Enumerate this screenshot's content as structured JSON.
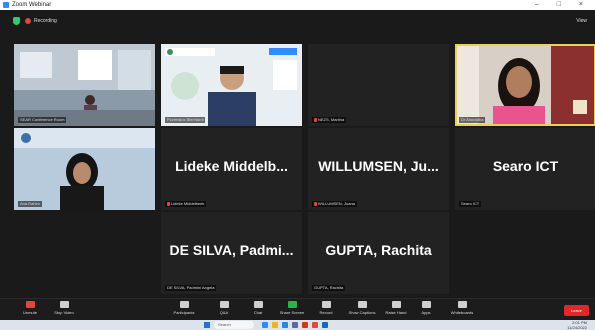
{
  "window": {
    "title": "Zoom Webinar",
    "controls": "– □ ×"
  },
  "topbar": {
    "recording_label": "Recording",
    "view_label": "View"
  },
  "tiles": [
    {
      "label": "SEAR Conference Room",
      "big_name": "",
      "video": "room"
    },
    {
      "label": "Florensius Blenhardi",
      "big_name": "",
      "video": "man"
    },
    {
      "label": "NEZS, Martina",
      "big_name": "",
      "video": "blank"
    },
    {
      "label": "Dr Anuradha",
      "big_name": "",
      "video": "woman",
      "active": true
    },
    {
      "label": "Ana Rahim",
      "big_name": "",
      "video": "hijab"
    },
    {
      "label": "Lideke Middelbeek",
      "big_name": "Lideke Middelb...",
      "video": "none"
    },
    {
      "label": "WILLUMSEN, Juana",
      "big_name": "WILLUMSEN, Ju...",
      "video": "none"
    },
    {
      "label": "Searo ICT",
      "big_name": "Searo ICT",
      "video": "none"
    },
    {
      "label": "",
      "big_name": "",
      "video": "empty"
    },
    {
      "label": "DE SILVA, Padmini Angela",
      "big_name": "DE SILVA, Padmi...",
      "video": "none"
    },
    {
      "label": "GUPTA, Rachita",
      "big_name": "GUPTA, Rachita",
      "video": "none"
    },
    {
      "label": "",
      "big_name": "",
      "video": "empty"
    }
  ],
  "toolbar": {
    "items": [
      {
        "label": "Unmute",
        "icon": "mic-icon"
      },
      {
        "label": "Stop Video",
        "icon": "video-icon"
      },
      {
        "label": "Participants",
        "icon": "participants-icon",
        "count": "82"
      },
      {
        "label": "Q&A",
        "icon": "qa-icon"
      },
      {
        "label": "Chat",
        "icon": "chat-icon"
      },
      {
        "label": "Share Screen",
        "icon": "share-screen-icon"
      },
      {
        "label": "Record",
        "icon": "record-icon"
      },
      {
        "label": "Show Captions",
        "icon": "captions-icon"
      },
      {
        "label": "Raise Hand",
        "icon": "raise-hand-icon"
      },
      {
        "label": "Apps",
        "icon": "apps-icon"
      },
      {
        "label": "Whiteboards",
        "icon": "whiteboard-icon"
      }
    ],
    "leave_label": "Leave"
  },
  "taskbar": {
    "search_placeholder": "Search",
    "time": "2:01 PM",
    "date": "11/24/2022"
  },
  "colors": {
    "active_speaker": "#e8d15a",
    "leave": "#e02828",
    "share": "#29b34a",
    "tile_bg": "#222222"
  }
}
